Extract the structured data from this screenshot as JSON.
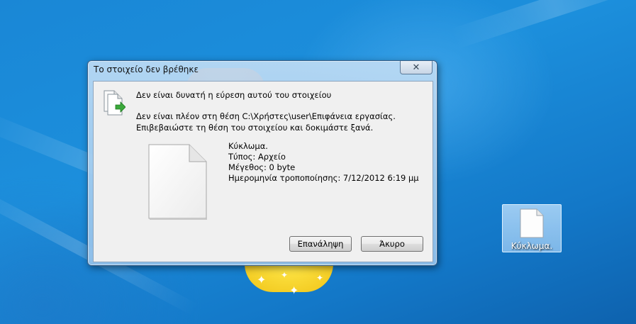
{
  "dialog": {
    "title": "Το στοιχείο δεν βρέθηκε",
    "close_label": "✕",
    "heading": "Δεν είναι δυνατή η εύρεση αυτού του στοιχείου",
    "line1": "Δεν είναι πλέον στη θέση C:\\Χρήστες\\user\\Επιφάνεια εργασίας.",
    "line2": "Επιβεβαιώστε τη θέση του στοιχείου και δοκιμάστε ξανά.",
    "file": {
      "name": "Κύκλωμα.",
      "type": "Τύπος: Αρχείο",
      "size": "Μέγεθος: 0 byte",
      "modified": "Ημερομηνία τροποποίησης: 7/12/2012 6:19 μμ"
    },
    "retry_label": "Επανάληψη",
    "cancel_label": "Άκυρο"
  },
  "desktop": {
    "icon_label": "Κύκλωμα."
  },
  "colors": {
    "desktop_blue": "#1a87d6",
    "dialog_bg": "#f0f0f0",
    "arrow_green": "#3aa83a"
  }
}
